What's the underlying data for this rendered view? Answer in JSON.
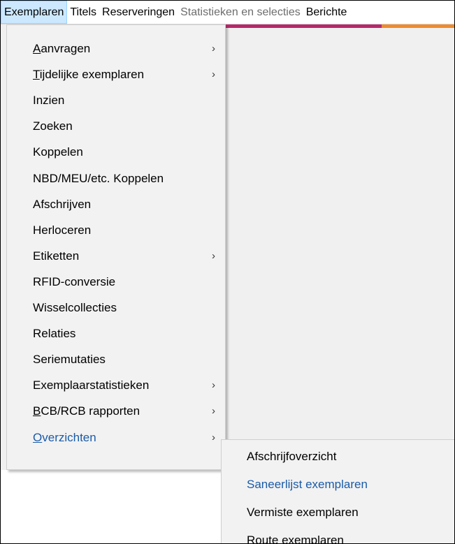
{
  "menubar": {
    "items": [
      {
        "label": "Exemplaren",
        "state": "active"
      },
      {
        "label": "Titels",
        "state": "normal"
      },
      {
        "label": "Reserveringen",
        "state": "normal"
      },
      {
        "label": "Statistieken en selecties",
        "state": "disabled"
      },
      {
        "label": "Berichte",
        "state": "normal"
      }
    ]
  },
  "colors": {
    "stripe_magenta": "#b8286a",
    "stripe_orange": "#f08a2c",
    "highlight_text": "#1a5ba8"
  },
  "dropdown": {
    "items": [
      {
        "mnemonic": "A",
        "rest": "anvragen",
        "submenu": true
      },
      {
        "mnemonic": "T",
        "rest": "ijdelijke exemplaren",
        "submenu": true
      },
      {
        "mnemonic": "",
        "rest": "Inzien",
        "submenu": false
      },
      {
        "mnemonic": "",
        "rest": "Zoeken",
        "submenu": false
      },
      {
        "mnemonic": "",
        "rest": "Koppelen",
        "submenu": false
      },
      {
        "mnemonic": "",
        "rest": "NBD/MEU/etc. Koppelen",
        "submenu": false
      },
      {
        "mnemonic": "",
        "rest": "Afschrijven",
        "submenu": false
      },
      {
        "mnemonic": "",
        "rest": "Herloceren",
        "submenu": false
      },
      {
        "mnemonic": "",
        "rest": "Etiketten",
        "submenu": true
      },
      {
        "mnemonic": "",
        "rest": "RFID-conversie",
        "submenu": false
      },
      {
        "mnemonic": "",
        "rest": "Wisselcollecties",
        "submenu": false
      },
      {
        "mnemonic": "",
        "rest": "Relaties",
        "submenu": false
      },
      {
        "mnemonic": "",
        "rest": "Seriemutaties",
        "submenu": false
      },
      {
        "mnemonic": "",
        "rest": "Exemplaarstatistieken",
        "submenu": true
      },
      {
        "mnemonic": "B",
        "rest": "CB/RCB rapporten",
        "submenu": true
      },
      {
        "mnemonic": "O",
        "rest": "verzichten",
        "submenu": true,
        "highlight": true
      }
    ],
    "chevron": "›"
  },
  "submenu": {
    "items": [
      {
        "label": "Afschrijfoverzicht",
        "highlight": false
      },
      {
        "label": "Saneerlijst exemplaren",
        "highlight": true
      },
      {
        "label": "Vermiste exemplaren",
        "highlight": false
      },
      {
        "label": "Route exemplaren",
        "highlight": false
      }
    ]
  }
}
